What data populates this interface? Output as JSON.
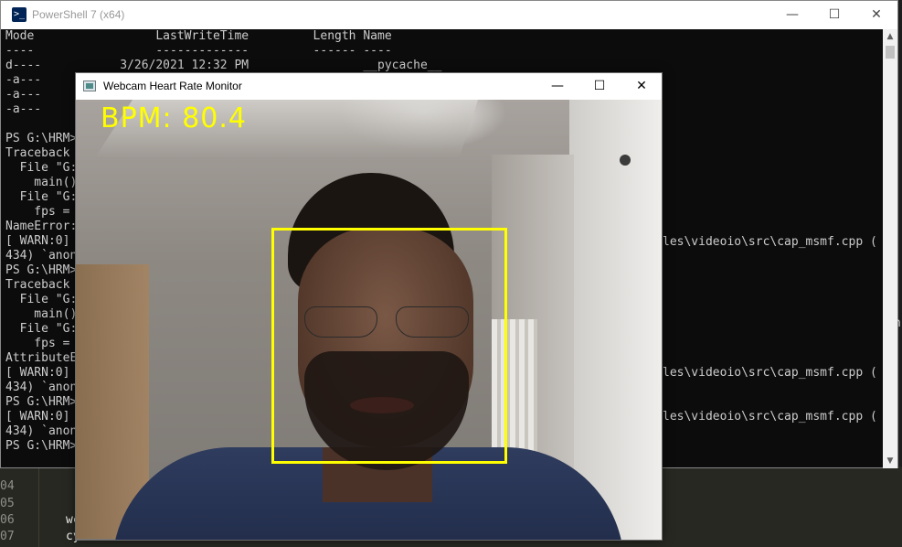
{
  "powershell": {
    "title": "PowerShell 7 (x64)",
    "icon": "powershell-icon",
    "lines": [
      "Mode                 LastWriteTime         Length Name",
      "----                 -------------         ------ ----",
      "d----           3/26/2021 12:32 PM                __pycache__",
      "-a---",
      "-a---",
      "-a---",
      "",
      "PS G:\\HRM>",
      "Traceback",
      "  File \"G:",
      "    main()",
      "  File \"G:",
      "    fps =",
      "NameError:",
      "[ WARN:0]",
      "434) `anon",
      "PS G:\\HRM>",
      "Traceback",
      "  File \"G:",
      "    main()",
      "  File \"G:",
      "    fps =",
      "AttributeE",
      "[ WARN:0]",
      "434) `anon",
      "PS G:\\HRM>",
      "[ WARN:0]",
      "434) `anon",
      "PS G:\\HRM>"
    ],
    "right_fragments": [
      "les\\videoio\\src\\cap_msmf.cpp (",
      "les\\videoio\\src\\cap_msmf.cpp (",
      "les\\videoio\\src\\cap_msmf.cpp ("
    ],
    "stray_n": "n",
    "line_prefix": "7",
    "minimize_glyph": "—",
    "maximize_glyph": "☐",
    "close_glyph": "✕"
  },
  "webcam": {
    "title": "Webcam Heart Rate Monitor",
    "bpm_text": "BPM: 80.4",
    "minimize_glyph": "—",
    "maximize_glyph": "☐",
    "close_glyph": "✕",
    "box_color": "#ffff00"
  },
  "editor": {
    "line_numbers": [
      "04",
      "05",
      "06",
      "07"
    ],
    "code_fragments": [
      "wc",
      "cy"
    ]
  }
}
